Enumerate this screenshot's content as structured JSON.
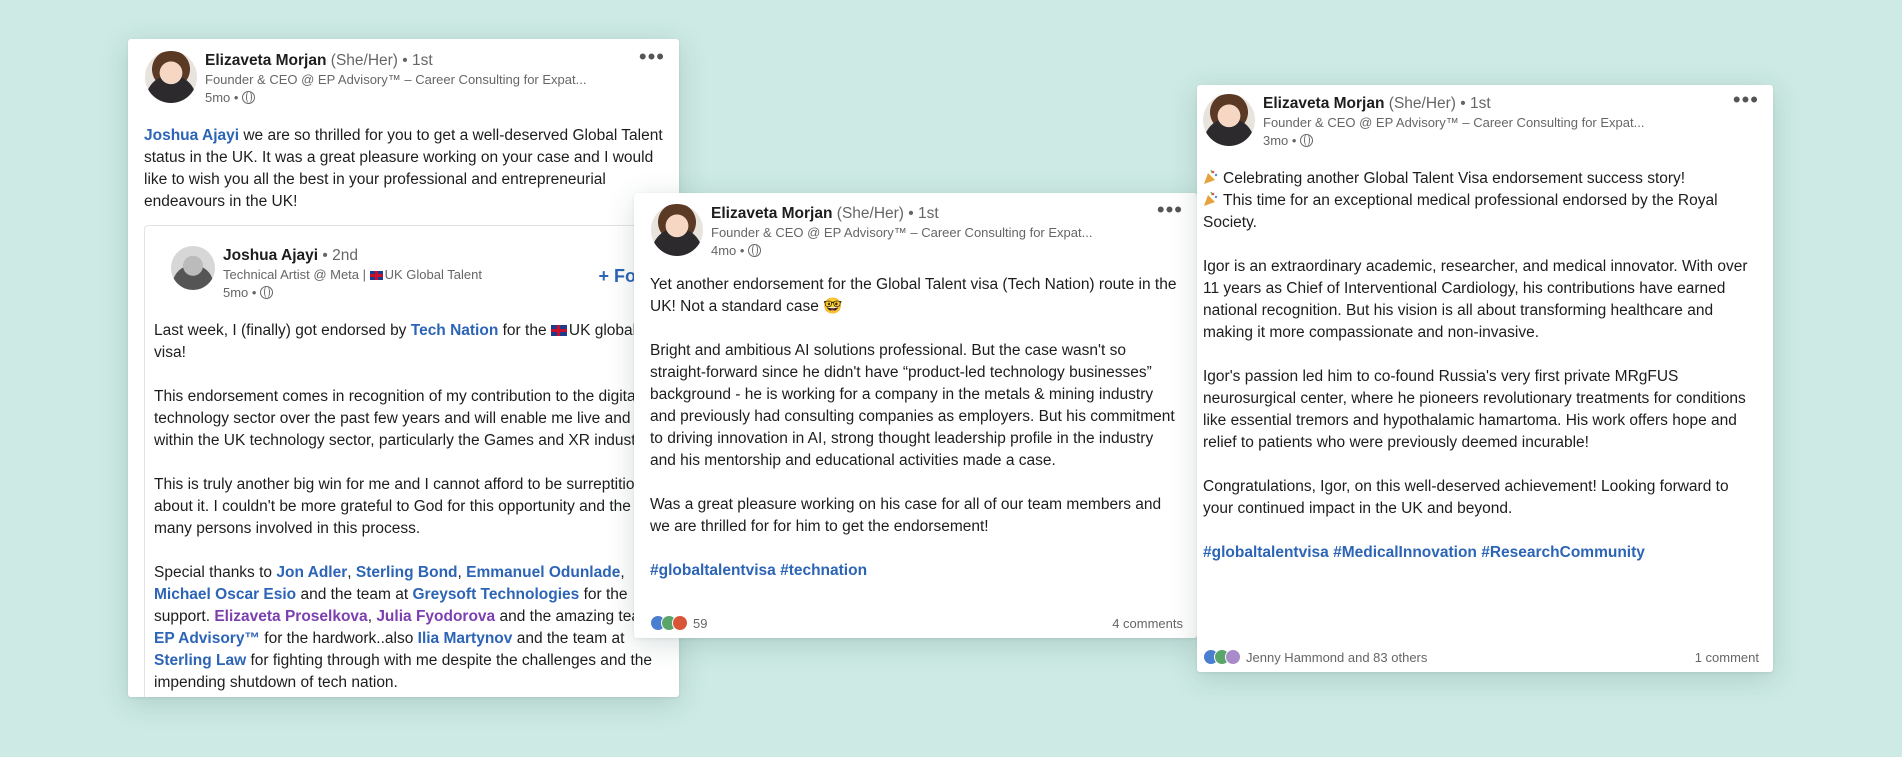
{
  "colors": {
    "background": "#cdeae4",
    "link": "#2c64b6",
    "mention_purple": "#7c3fb0"
  },
  "card1": {
    "author": "Elizaveta Morjan",
    "pronouns": "(She/Her)",
    "degree": "• 1st",
    "headline": "Founder & CEO @ EP Advisory™ – Career Consulting for Expat...",
    "time": "5mo •",
    "more_icon": "more-dots-icon",
    "comment": {
      "mention": "Joshua Ajayi",
      "text": " we are so thrilled for you to get a well-deserved Global Talent status in the UK. It was a great pleasure working on your case and I would like to wish you all the best in your professional and entrepreneurial endeavours in the UK!"
    },
    "shared_post": {
      "author": "Joshua Ajayi",
      "degree": "• 2nd",
      "headline_part1": "Technical Artist @ Meta | ",
      "headline_part2": "UK Global Talent",
      "time": "5mo •",
      "follow_label": "+ Follow",
      "p1_a": "Last week, I (finally) got endorsed by ",
      "p1_mention": "Tech Nation",
      "p1_b": " for the ",
      "p1_c": "UK global talent visa!",
      "p2": "This endorsement comes in recognition of my contribution to the digital technology sector over the past few years and will enable me live and work within the UK technology sector, particularly the Games and XR industry.",
      "p3": "This is truly another big win for me and I cannot afford to be surreptitious about it. I couldn't be more grateful to God for this opportunity and the very many persons involved in this process.",
      "p4_a": "Special thanks to ",
      "m_jon": "Jon Adler",
      "c1": ", ",
      "m_sterling": "Sterling Bond",
      "c2": ", ",
      "m_emmanuel": "Emmanuel Odunlade",
      "c3": ", ",
      "m_michael": "Michael Oscar Esio",
      "p4_b": " and the team at ",
      "m_greysoft": "Greysoft Technologies",
      "p4_c": " for the support. ",
      "m_elizaveta": "Elizaveta Proselkova",
      "c4": ", ",
      "m_julia": "Julia Fyodorova",
      "p4_d": " and the amazing team at ",
      "m_ep": "EP Advisory™",
      "p4_e": " for the hardwork..also ",
      "m_ilia": "Ilia Martynov",
      "p4_f": " and the team at ",
      "m_law": "Sterling Law",
      "p4_g": " for fighting through with me despite the challenges and the impending shutdown of tech nation."
    }
  },
  "card2": {
    "author": "Elizaveta Morjan",
    "pronouns": "(She/Her)",
    "degree": "• 1st",
    "headline": "Founder & CEO @ EP Advisory™ – Career Consulting for Expat...",
    "time": "4mo •",
    "p1": "Yet another endorsement for the Global Talent visa (Tech Nation) route in the UK! Not a standard case 🤓",
    "p2": "Bright and ambitious AI solutions professional. But the case wasn't so straight-forward since he didn't have “product-led technology businesses” background - he is working for a company in the metals & mining industry and previously had consulting companies as employers. But his commitment to driving innovation in AI, strong thought leadership profile in the industry and his mentorship and educational activities made a case.",
    "p3": "Was a great pleasure working on his case for all of our team members and we are thrilled for for him to get the endorsement!",
    "hashtags": "#globaltalentvisa #technation",
    "reaction_count": "59",
    "comments": "4 comments"
  },
  "card3": {
    "author": "Elizaveta Morjan",
    "pronouns": "(She/Her)",
    "degree": "• 1st",
    "headline": "Founder & CEO @ EP Advisory™ – Career Consulting for Expat...",
    "time": "3mo •",
    "l1": "Celebrating another Global Talent Visa endorsement success story!",
    "l2": "This time for an exceptional medical professional endorsed by the Royal Society.",
    "p2": "Igor is an extraordinary academic, researcher, and medical innovator. With over 11 years as Chief of Interventional Cardiology, his contributions have earned national recognition. But his vision is all about transforming healthcare and making it more compassionate and non-invasive.",
    "p3": "Igor's passion led him to co-found Russia's very first private MRgFUS neurosurgical center, where he pioneers revolutionary treatments for conditions like essential tremors and hypothalamic hamartoma. His work offers hope and relief to patients who were previously deemed incurable!",
    "p4": "Congratulations, Igor, on this well-deserved achievement! Looking forward to your continued impact in the UK and beyond.",
    "hashtags": "#globaltalentvisa #MedicalInnovation #ResearchCommunity",
    "reactions_text": "Jenny Hammond and 83 others",
    "comments": "1 comment"
  }
}
